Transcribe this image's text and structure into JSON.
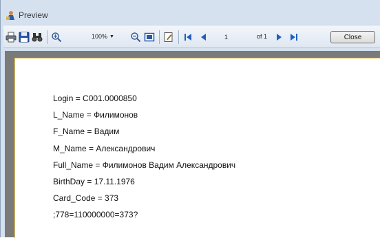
{
  "window": {
    "title": "Preview",
    "icon": "preview-app-icon"
  },
  "toolbar": {
    "zoom_value": "100%",
    "page_number": "1",
    "page_of": "of 1",
    "close_label": "Close",
    "icons": [
      "print-icon",
      "save-icon",
      "find-icon",
      "zoom-in-icon",
      "zoom-out-icon",
      "fit-page-icon",
      "page-setup-icon",
      "first-page-icon",
      "previous-page-icon",
      "next-page-icon",
      "last-page-icon"
    ]
  },
  "report": {
    "lines": [
      "Login = C001.0000850",
      "L_Name = Филимонов",
      "F_Name = Вадим",
      "M_Name = Александрович",
      "Full_Name = Филимонов Вадим Александрович",
      "BirthDay = 17.11.1976",
      "Card_Code = 373",
      ";778=110000000=373?"
    ]
  },
  "colors": {
    "window_bg": "#d6e1ef",
    "page_border": "#e1c24a",
    "canvas_gray": "#7a7a7a",
    "nav_blue": "#1f5fbf"
  }
}
